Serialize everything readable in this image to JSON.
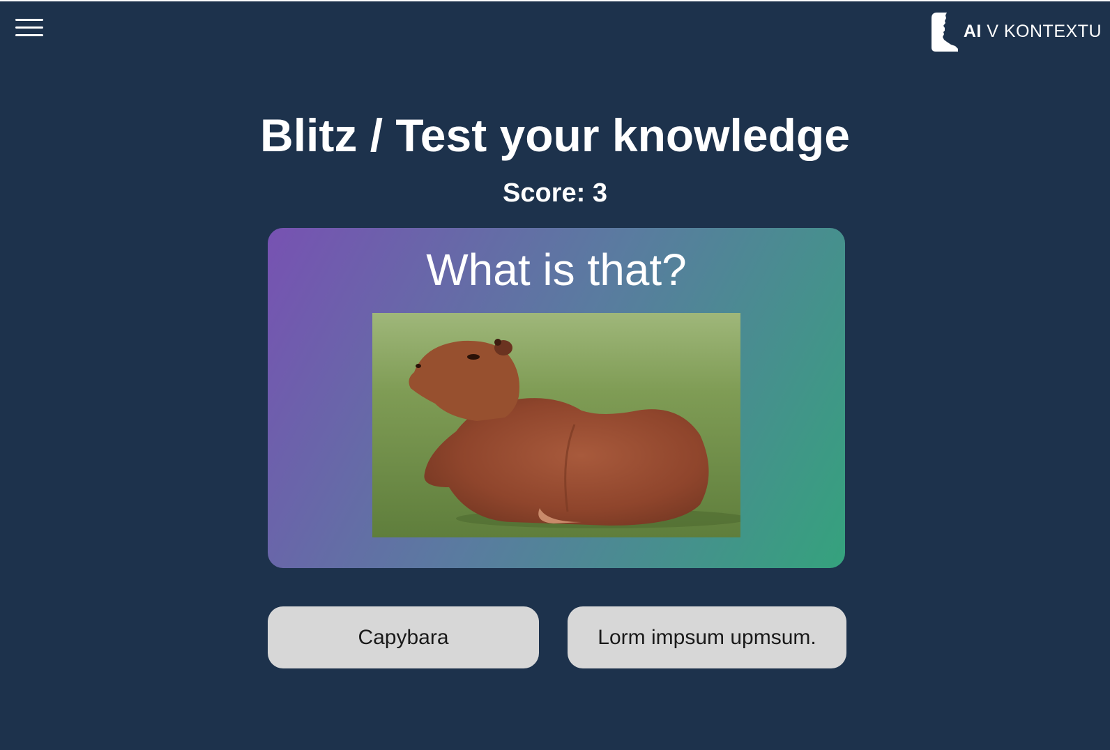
{
  "header": {
    "menu_icon": "hamburger-menu-icon",
    "logo_icon": "head-profile-icon",
    "logo_text_ai": "AI",
    "logo_text_rest": " V KONTEXTU"
  },
  "quiz": {
    "title": "Blitz / Test your knowledge",
    "score": "Score: 3",
    "question": "What is that?",
    "image_subject": "capybara lying on grass",
    "answers": [
      "Capybara",
      "Lorm impsum upmsum."
    ]
  },
  "colors": {
    "background": "#1d324c",
    "card_gradient_start": "#7752b2",
    "card_gradient_end": "#35a27d",
    "answer_button": "#d7d7d7"
  }
}
